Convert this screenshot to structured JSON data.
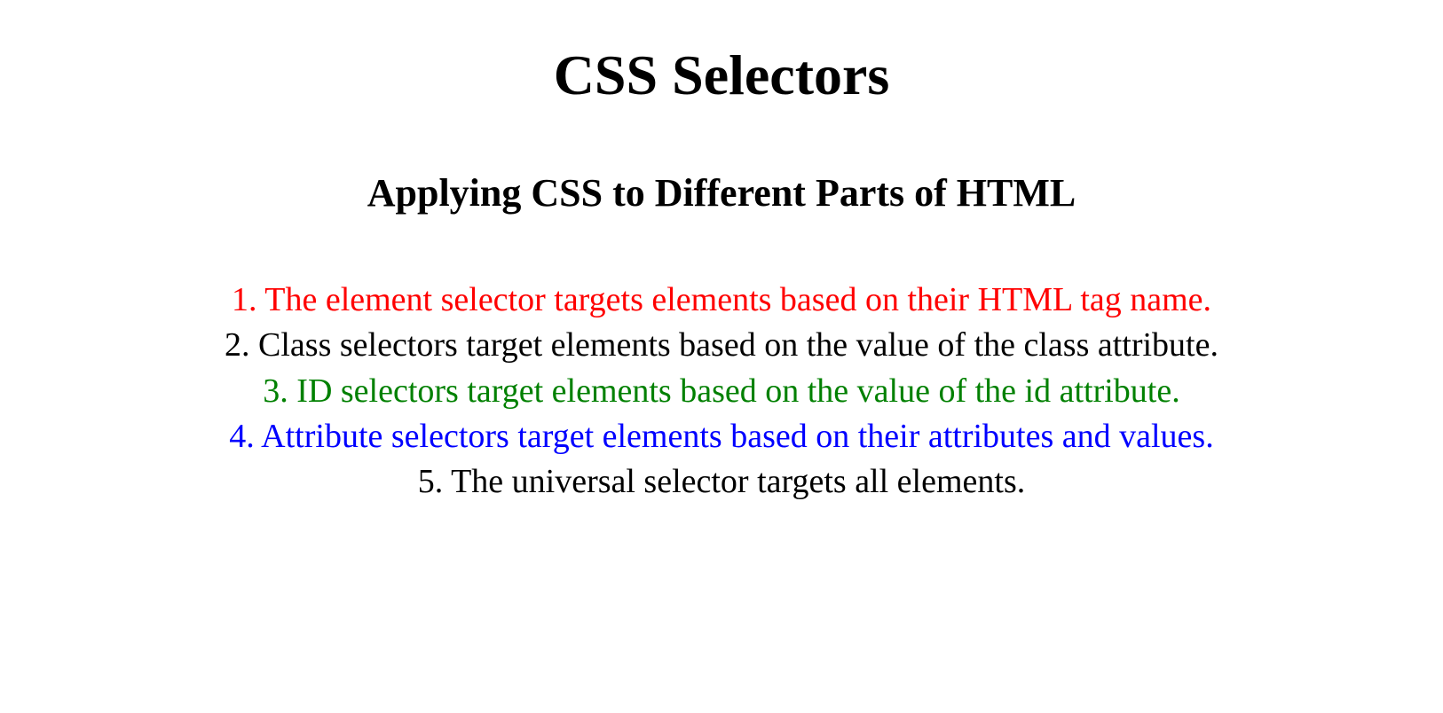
{
  "title": "CSS Selectors",
  "subtitle": "Applying CSS to Different Parts of HTML",
  "items": [
    {
      "text": "1. The element selector targets elements based on their HTML tag name.",
      "color": "red"
    },
    {
      "text": "2. Class selectors target elements based on the value of the class attribute.",
      "color": "black"
    },
    {
      "text": "3. ID selectors target elements based on the value of the id attribute.",
      "color": "green"
    },
    {
      "text": "4. Attribute selectors target elements based on their attributes and values.",
      "color": "blue"
    },
    {
      "text": "5. The universal selector targets all elements.",
      "color": "black"
    }
  ]
}
